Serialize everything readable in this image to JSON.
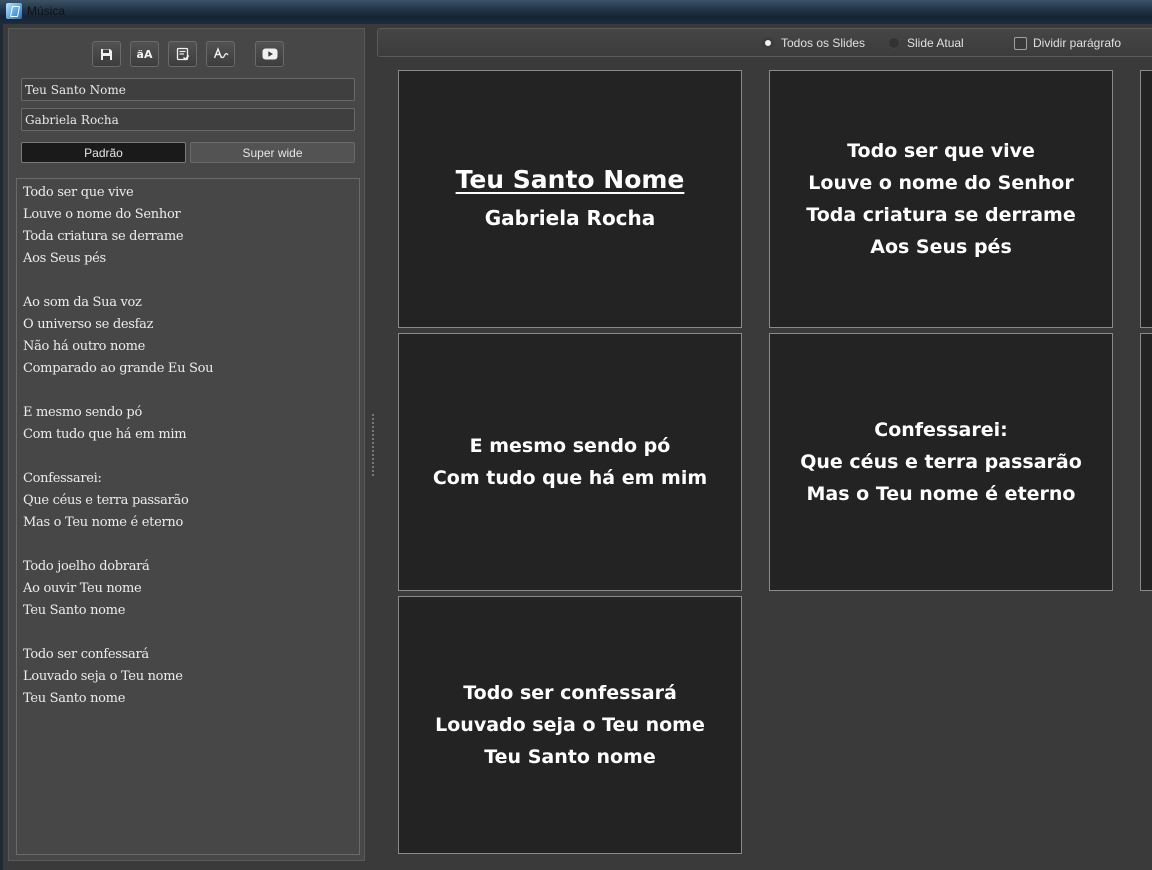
{
  "window": {
    "title": "Música"
  },
  "toolbar": {
    "buttons": [
      {
        "name": "save",
        "label": ""
      },
      {
        "name": "font",
        "label": "äA"
      },
      {
        "name": "checklist",
        "label": ""
      },
      {
        "name": "spellcheck",
        "label": ""
      },
      {
        "name": "youtube",
        "label": ""
      }
    ]
  },
  "form": {
    "title_value": "Teu Santo Nome",
    "artist_value": "Gabriela Rocha"
  },
  "format": {
    "standard_label": "Padrão",
    "superwide_label": "Super wide",
    "selected": "Padrão"
  },
  "lyrics": {
    "lines": [
      "Todo ser que vive",
      "Louve o nome do Senhor",
      "Toda criatura se derrame",
      "Aos Seus pés",
      "",
      "Ao som da Sua voz",
      "O universo se desfaz",
      "Não há outro nome",
      "Comparado ao grande Eu Sou",
      "",
      "E mesmo sendo pó",
      "Com tudo que há em mim",
      "",
      "Confessarei:",
      "Que céus e terra passarão",
      "Mas o Teu nome é eterno",
      "",
      "Todo joelho dobrará",
      "Ao ouvir Teu nome",
      "Teu Santo nome",
      "",
      "Todo ser confessará",
      "Louvado seja o Teu nome",
      "Teu Santo nome"
    ]
  },
  "options": {
    "all_slides_label": "Todos os Slides",
    "current_slide_label": "Slide Atual",
    "split_paragraph_label": "Dividir parágrafo",
    "selected": "Todos os Slides",
    "split_paragraph_checked": false
  },
  "slides": {
    "title_slide": {
      "title": "Teu Santo Nome",
      "artist": "Gabriela Rocha"
    },
    "slide2": [
      "Todo ser que vive",
      "Louve o nome do Senhor",
      "Toda criatura se derrame",
      "Aos Seus pés"
    ],
    "slide3": [
      "E mesmo sendo pó",
      "Com tudo que há em mim"
    ],
    "slide4": [
      "Confessarei:",
      "Que céus e terra passarão",
      "Mas o Teu nome é eterno"
    ],
    "slide5": [
      "Todo ser confessará",
      "Louvado seja o Teu nome",
      "Teu Santo nome"
    ]
  },
  "colors": {
    "panel": "#474747",
    "slide_bg": "#232323",
    "slide_text": "#ffffff"
  }
}
